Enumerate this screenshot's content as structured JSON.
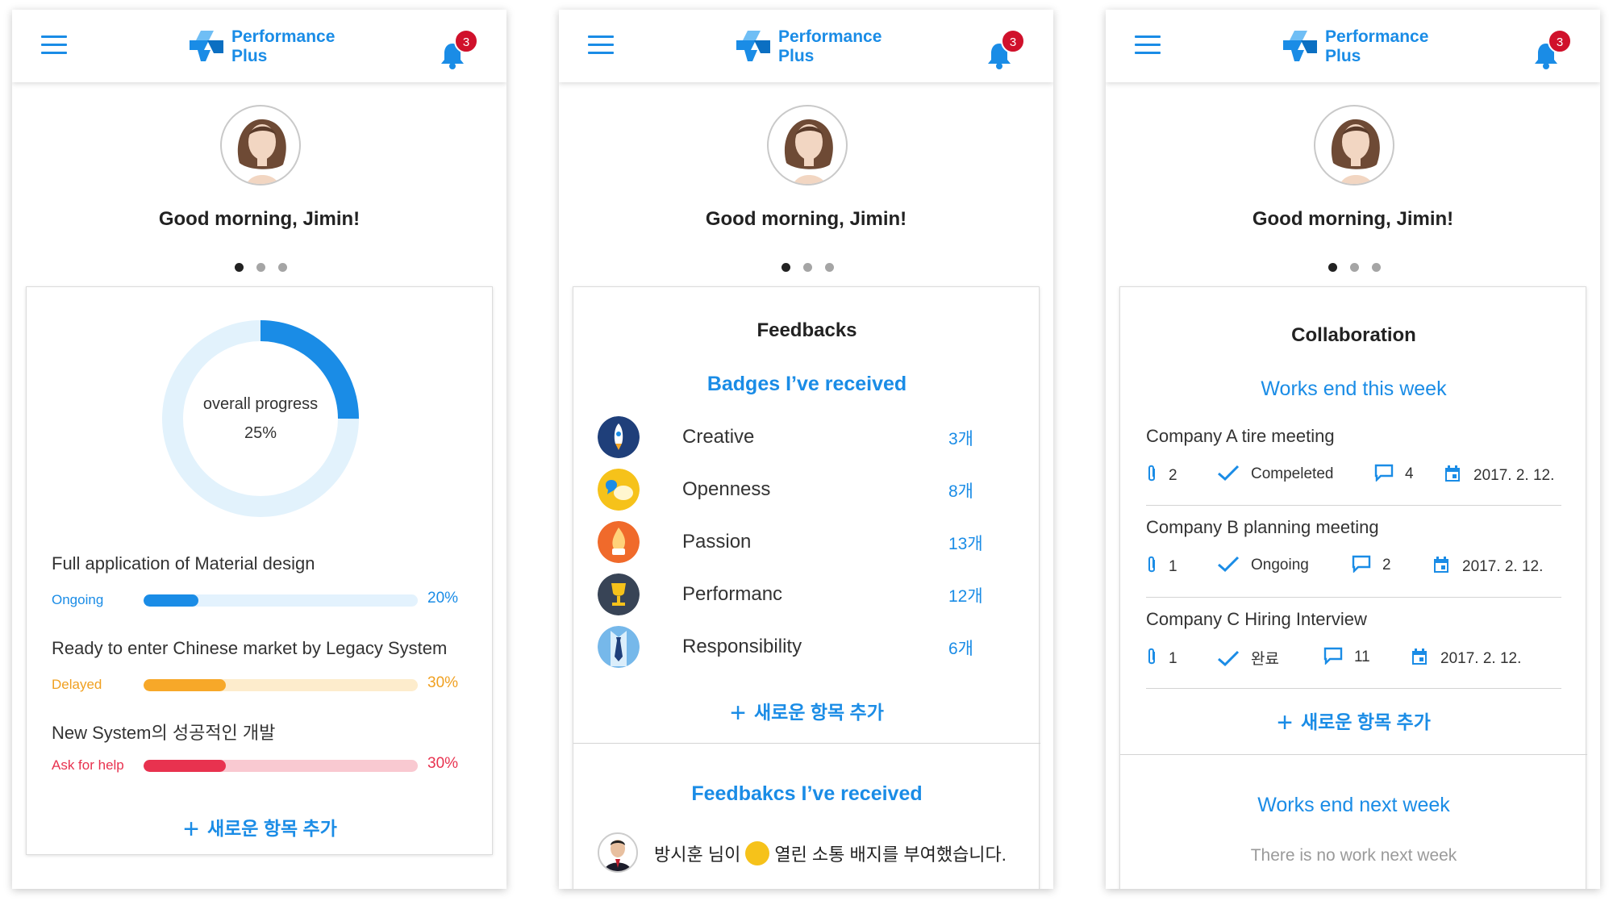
{
  "app": {
    "logo_line1": "Performance",
    "logo_line2": "Plus",
    "notification_count": "3",
    "brand_color": "#1a8ce6"
  },
  "greeting": "Good morning, Jimin!",
  "add_new": "새로운 항목 추가",
  "screen1": {
    "overall_progress_label": "overall progress",
    "overall_progress_value": "25%",
    "overall_progress_fraction": 0.25,
    "projects": [
      {
        "title": "Full application of Material design",
        "status": "Ongoing",
        "percent": "20%",
        "fraction": 0.2,
        "color": "#1a8ce6",
        "track": "#e3f2fd"
      },
      {
        "title": "Ready to enter Chinese market by Legacy System",
        "status": "Delayed",
        "percent": "30%",
        "fraction": 0.3,
        "color": "#f7a829",
        "track": "#fdeccc"
      },
      {
        "title": "New System의 성공적인 개발",
        "status": "Ask  for help",
        "percent": "30%",
        "fraction": 0.3,
        "color": "#e8324f",
        "track": "#f9c9d1"
      }
    ]
  },
  "screen2": {
    "title": "Feedbacks",
    "badges_title": "Badges I’ve received",
    "badges": [
      {
        "name": "Creative",
        "count": "3개",
        "icon": "rocket-badge-icon",
        "color": "#1f3f7a"
      },
      {
        "name": "Openness",
        "count": "8개",
        "icon": "speech-bubbles-badge-icon",
        "color": "#f6c21a"
      },
      {
        "name": "Passion",
        "count": "13개",
        "icon": "flame-badge-icon",
        "color": "#f06a2b"
      },
      {
        "name": "Performanc",
        "count": "12개",
        "icon": "trophy-badge-icon",
        "color": "#384456"
      },
      {
        "name": "Responsibility",
        "count": "6개",
        "icon": "necktie-badge-icon",
        "color": "#76b8ea"
      }
    ],
    "feedbacks_title": "Feedbakcs I’ve received",
    "feedback_item": {
      "sender": "방시훈 님이",
      "message": "열린 소통 배지를 부여했습니다."
    }
  },
  "screen3": {
    "title": "Collaboration",
    "this_week_title": "Works end this week",
    "items": [
      {
        "title": "Company A tire meeting",
        "attachments": "2",
        "status": "Compeleted",
        "comments": "4",
        "date": "2017. 2. 12."
      },
      {
        "title": "Company B planning meeting",
        "attachments": "1",
        "status": "Ongoing",
        "comments": "2",
        "date": "2017. 2. 12."
      },
      {
        "title": "Company C Hiring Interview",
        "attachments": "1",
        "status": "완료",
        "comments": "11",
        "date": "2017. 2. 12."
      }
    ],
    "next_week_title": "Works end next week",
    "next_week_empty": "There is no work next week"
  }
}
